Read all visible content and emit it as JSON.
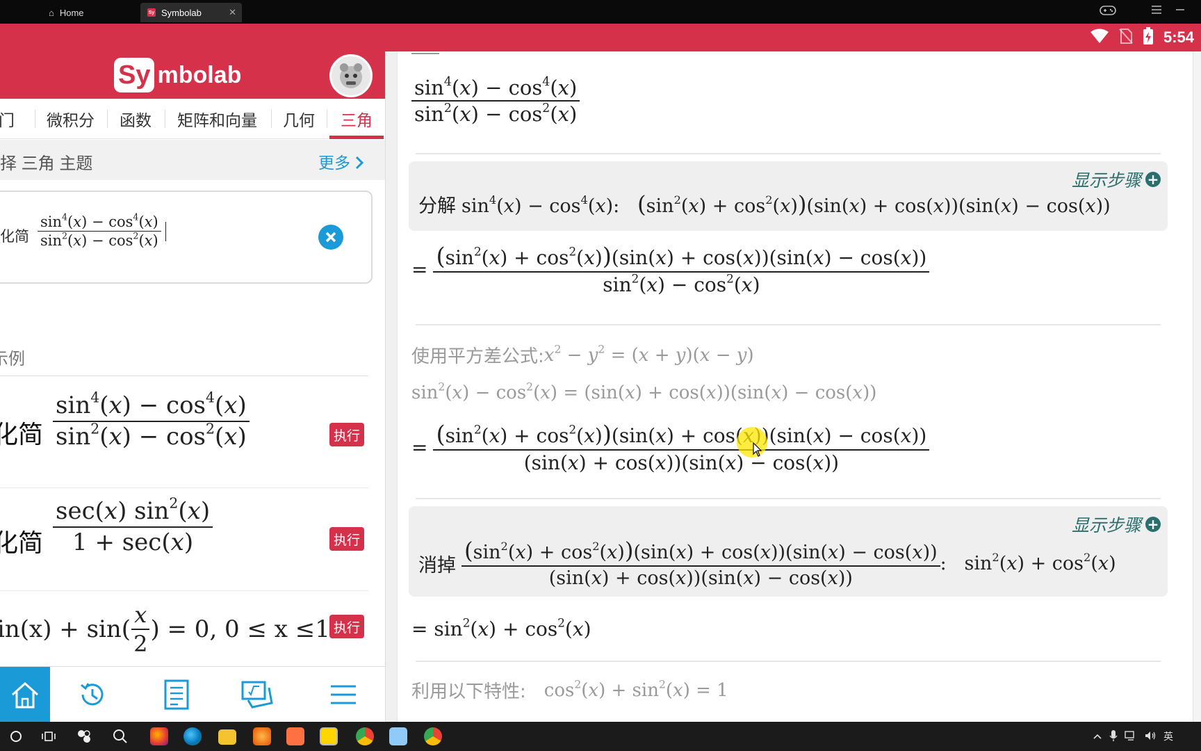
{
  "window": {
    "tabs": [
      {
        "label": "Home",
        "icon": "home-icon"
      },
      {
        "label": "Symbolab",
        "icon": "symbolab-favicon"
      }
    ],
    "favicon_text": "Sy",
    "close_glyph": "✕"
  },
  "status": {
    "time": "5:54"
  },
  "left": {
    "logo_sy": "Sy",
    "logo_rest": "mbolab",
    "nav_tabs": [
      "入门",
      "微积分",
      "函数",
      "矩阵和向量",
      "几何",
      "三角"
    ],
    "nav_tabs_visible": [
      "门",
      "微积分",
      "函数",
      "矩阵和向量",
      "几何",
      "三角"
    ],
    "topic_label": "择 三角 主题",
    "more_label": "更多",
    "input_prefix": "化简",
    "examples_heading": "示例",
    "examples_heading_visible": "示例",
    "run_label": "执行",
    "example_prefix_visible": "化简",
    "example3_prefix": "in(x) + sin(",
    "example3_rest": ") = 0,  0 ≤  x ≤ ",
    "example3_cut": "1"
  },
  "right": {
    "show_steps_label": "显示步骤",
    "factor_label": "分解",
    "cancel_label": "消掉",
    "diff_squares_label": "使用平方差公式:",
    "identity_label": "利用以下特性:",
    "colors": {
      "accent": "#d6314b",
      "link": "#1a9bd7",
      "steps": "#2a6e6e"
    }
  }
}
